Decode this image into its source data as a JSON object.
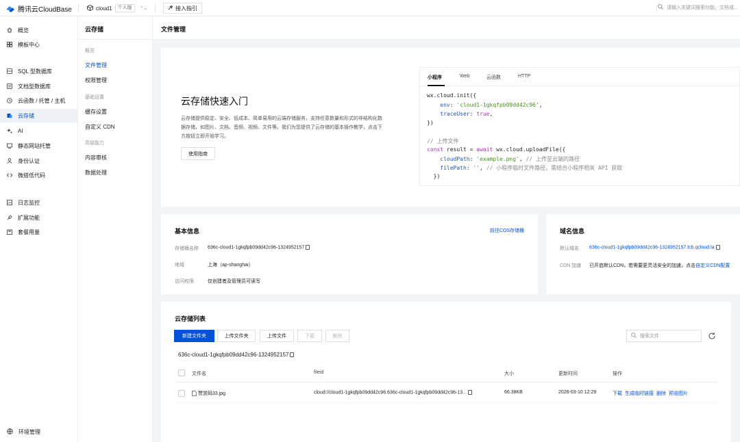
{
  "topbar": {
    "brand": "腾讯云CloudBase",
    "env_name": "cloud1",
    "env_tag": "个人版",
    "guide_label": "接入指引",
    "search_placeholder": "请输入关键词搜索功能、文档或..."
  },
  "leftnav": {
    "items": [
      {
        "label": "概览",
        "icon": "home-icon"
      },
      {
        "label": "模板中心",
        "icon": "grid-icon"
      },
      {
        "label": "SQL 型数据库",
        "icon": "database-icon"
      },
      {
        "label": "文档型数据库",
        "icon": "document-database-icon"
      },
      {
        "label": "云函数 / 托管 / 主机",
        "icon": "function-icon"
      },
      {
        "label": "云存储",
        "icon": "storage-icon"
      },
      {
        "label": "AI",
        "icon": "sparkle-icon"
      },
      {
        "label": "静态网站托管",
        "icon": "website-icon"
      },
      {
        "label": "身份认证",
        "icon": "user-icon"
      },
      {
        "label": "微搭低代码",
        "icon": "lowcode-icon"
      },
      {
        "label": "日志监控",
        "icon": "monitor-icon"
      },
      {
        "label": "扩展功能",
        "icon": "extension-icon"
      },
      {
        "label": "套餐用量",
        "icon": "package-icon"
      }
    ],
    "env_management": "环境管理"
  },
  "subnav": {
    "title": "云存储",
    "groups": [
      {
        "label": "概览"
      },
      {
        "label": "基础设置"
      },
      {
        "label": "高级能力"
      }
    ],
    "items": [
      "文件管理",
      "权限管理",
      "缓存设置",
      "自定义 CDN",
      "内容审核",
      "数据处理"
    ]
  },
  "page": {
    "title": "文件管理"
  },
  "quickstart": {
    "title": "云存储快速入门",
    "description": "云存储提供稳定、安全、低成本、简单易用的云端存储服务，支持任意数量和形式的非结构化数据存储，如图片、文档、音频、视频、文件等。我们为您提供了云存储的基本操作教学，点击下方按钮立即开始学习。",
    "guide_button": "使用指南",
    "tabs": [
      "小程序",
      "Web",
      "云函数",
      "HTTP"
    ],
    "code": {
      "l1": "wx.cloud.init({",
      "l2_key": "env",
      "l2_val": "'cloud1-1gkqfpb09dd42c96'",
      "l3_key": "traceUser",
      "l3_val": "true",
      "l4": "})",
      "l5": "// 上传文件",
      "l6_kw1": "const",
      "l6_mid": " result = ",
      "l6_kw2": "await",
      "l6_end": " wx.cloud.uploadFile({",
      "l7_key": "cloudPath",
      "l7_val": "'example.png'",
      "l7_cmt": "// 上传至云端的路径",
      "l8_key": "filePath",
      "l8_val": "''",
      "l8_cmt": "// 小程序临时文件路径，需结合小程序相关 API 获取",
      "l9": "})"
    }
  },
  "basic_info": {
    "title": "基本信息",
    "cos_link": "前往COS存储桶",
    "bucket_label": "存储桶名称",
    "bucket_value": "636c-cloud1-1gkqfpb09dd42c96-1324952157",
    "region_label": "地域",
    "region_value": "上海（ap-shanghai）",
    "access_label": "访问权限",
    "access_value": "仅创建者及管理员可读写"
  },
  "domain_info": {
    "title": "域名信息",
    "default_label": "默认域名",
    "default_value": "636c-cloud1-1gkqfpb09dd42c96-1324952157.tcb.qcloud.la",
    "cdn_label": "CDN 加速",
    "cdn_text": "已开启默认CDN，若需要更灵活安全的加速，点击",
    "cdn_link": "自定义CDN配置"
  },
  "storage_list": {
    "title": "云存储列表",
    "buttons": {
      "new_folder": "新建文件夹",
      "upload_folder": "上传文件夹",
      "upload_file": "上传文件",
      "download": "下载",
      "delete": "删除"
    },
    "search_placeholder": "搜索文件",
    "path": "636c-cloud1-1gkqfpb09dd42c96-1324952157",
    "columns": [
      "文件名",
      "fileid",
      "大小",
      "更新时间",
      "操作"
    ],
    "rows": [
      {
        "name": "赞赏码33.jpg",
        "fileid": "cloud://cloud1-1gkqfpb09dd42c96.636c-cloud1-1gkqfpb09dd42c96-13...",
        "size": "66.38KB",
        "updated": "2026-03-10 12:29",
        "ops": [
          "下载",
          "生成临时链接",
          "删除",
          "预览图片"
        ]
      }
    ]
  },
  "colors": {
    "accent": "#0052d9",
    "active_bg": "#eef1f6"
  }
}
